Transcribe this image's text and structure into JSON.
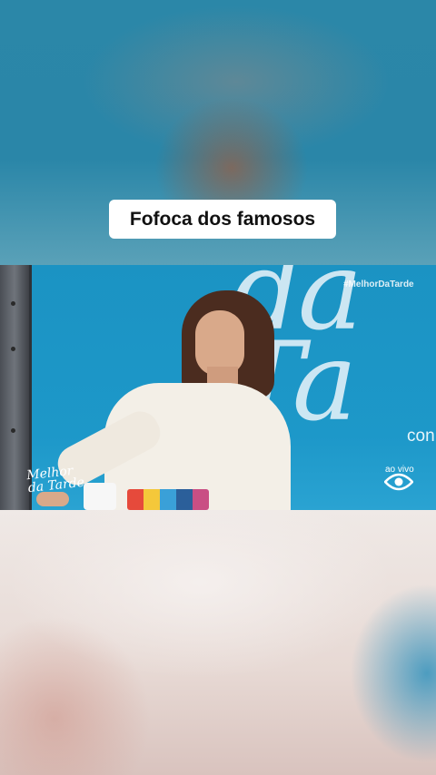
{
  "caption": "Fofoca dos famosos",
  "video": {
    "background_text": "da Ta",
    "hashtag": "#MelhorDaTarde",
    "partial_text": "con",
    "live_label": "ao vivo",
    "logo_line1": "Melhor",
    "logo_line2": "da Tarde"
  },
  "colors": {
    "studio_blue": "#1d98c9",
    "caption_bg": "#ffffff",
    "caption_text": "#111111"
  }
}
